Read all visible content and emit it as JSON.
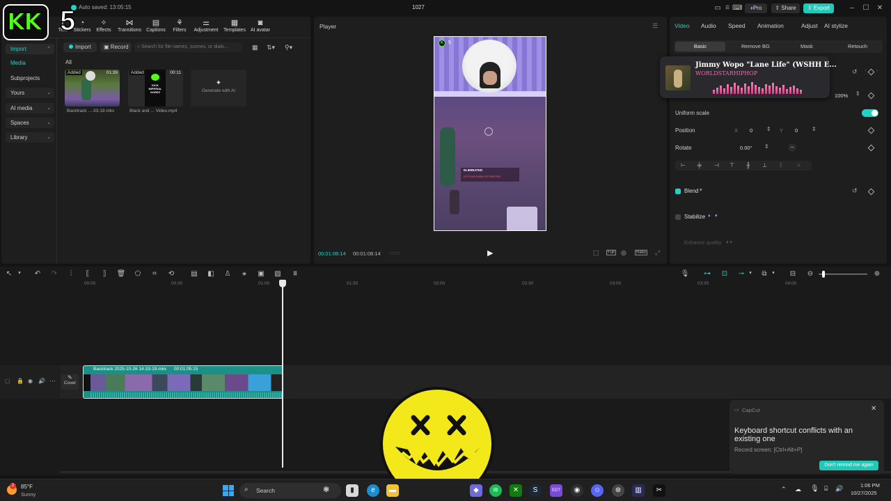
{
  "titlebar": {
    "auto_saved": "Auto saved: 13:05:15",
    "project_name": "1027",
    "pro_label": "Pro",
    "share_label": "Share",
    "export_label": "Export"
  },
  "overlay": {
    "logo_text": "KK",
    "number": "5"
  },
  "toolbar": {
    "items": [
      "Text",
      "Stickers",
      "Effects",
      "Transitions",
      "Captions",
      "Filters",
      "Adjustment",
      "Templates",
      "AI avatar"
    ]
  },
  "sidebar": {
    "items": [
      {
        "label": "Import",
        "has_caret": true
      },
      {
        "label": "Media",
        "has_caret": false
      },
      {
        "label": "Subprojects",
        "has_caret": false
      },
      {
        "label": "Yours",
        "has_caret": true
      },
      {
        "label": "AI media",
        "has_caret": true
      },
      {
        "label": "Spaces",
        "has_caret": true
      },
      {
        "label": "Library",
        "has_caret": true
      }
    ]
  },
  "media": {
    "import_label": "Import",
    "record_label": "Record",
    "search_placeholder": "Search for file names, scenes, or dialo...",
    "filter_all": "All",
    "clips": [
      {
        "badge": "Added",
        "duration": "01:39",
        "name": "Backtrack ...-33-19.mkv"
      },
      {
        "badge": "Added",
        "duration": "00:11",
        "name": "Black and ... Video.mp4"
      }
    ],
    "generate_label": "Generate with AI",
    "thumb_text": "KICK IMPERIAL GOREZ"
  },
  "player": {
    "title": "Player",
    "current_time": "00:01:08:14",
    "total_time": "00:01:08:14",
    "ratio_label": "Ratio",
    "full_label": "Full",
    "kill_feed_1": "ELIMINATED",
    "kill_feed_2": "LET'S HOLD KING OF EMOTION"
  },
  "props": {
    "tabs": [
      "Video",
      "Audio",
      "Speed",
      "Animation",
      "Adjust",
      "AI stylize"
    ],
    "subtabs": [
      "Basic",
      "Remove BG",
      "Mask",
      "Retouch"
    ],
    "scale_value": "100%",
    "uniform_scale": "Uniform scale",
    "position": "Position",
    "pos_x_label": "X",
    "pos_x": "0",
    "pos_y_label": "Y",
    "pos_y": "0",
    "rotate": "Rotate",
    "rotate_value": "0.00°",
    "blend": "Blend",
    "stabilize": "Stabilize",
    "enhance_quality": "Enhance quality"
  },
  "now_playing": {
    "title": "Jimmy Wopo \"Lane Life\" (WSHH E...",
    "artist": "WORLDSTARHIPHOP",
    "wave": [
      6,
      9,
      12,
      8,
      14,
      10,
      16,
      12,
      9,
      15,
      11,
      17,
      13,
      10,
      8,
      14,
      12,
      16,
      11,
      9,
      13,
      7,
      10,
      12,
      8,
      6
    ]
  },
  "timeline": {
    "ticks": [
      "00:00",
      "00:30",
      "01:00",
      "01:30",
      "02:00",
      "02:30",
      "03:00",
      "03:30",
      "04:00"
    ],
    "clip_name": "Backtrack 2025-10-26 14-33-19.mkv",
    "clip_duration": "00:01:05:15",
    "cover_label": "Cover"
  },
  "toast": {
    "app": "CapCut",
    "message": "Keyboard shortcut conflicts with an existing one",
    "detail": "Record screen: [Ctrl+Alt+P]",
    "button": "Don't remind me again"
  },
  "taskbar": {
    "weather_temp": "85°F",
    "weather_desc": "Sunny",
    "weather_badge": "2",
    "search_label": "Search",
    "time": "1:06 PM",
    "date": "10/27/2025"
  },
  "colors": {
    "accent": "#22d3c5",
    "brand_teal": "#1fb8b0",
    "pro_purple": "#7b5cff",
    "smiley_yellow": "#f3e81a"
  }
}
